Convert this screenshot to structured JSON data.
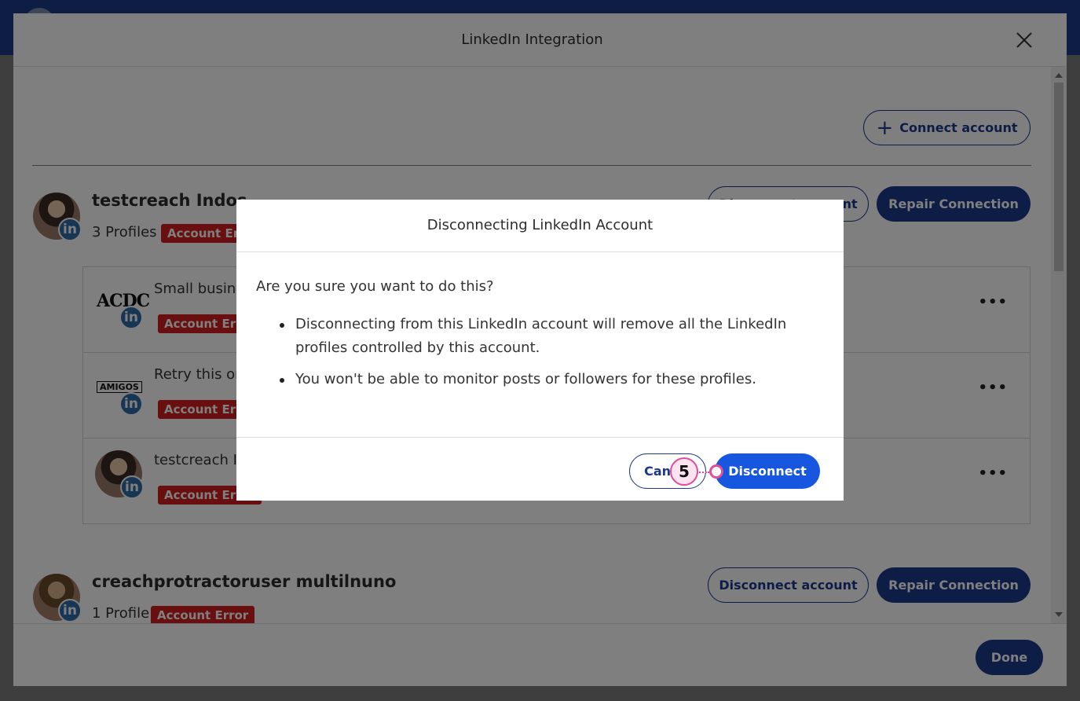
{
  "modal": {
    "title": "LinkedIn Integration",
    "connect_label": "Connect account",
    "done_label": "Done"
  },
  "accounts": [
    {
      "name": "testcreach Indos",
      "profiles_count": "3 Profiles",
      "error_badge": "Account Error",
      "disconnect_label": "Disconnect account",
      "repair_label": "Repair Connection",
      "profiles": [
        {
          "title": "Small business ...",
          "error_badge": "Account Error",
          "logo": "ACDC"
        },
        {
          "title": "Retry this one ...",
          "error_badge": "Account Error",
          "logo": "AMIGOS"
        },
        {
          "title": "testcreach Indos",
          "error_badge": "Account Error"
        }
      ]
    },
    {
      "name": "creachprotractoruser multilnuno",
      "profiles_count": "1 Profile",
      "error_badge": "Account Error",
      "disconnect_label": "Disconnect account",
      "repair_label": "Repair Connection"
    }
  ],
  "linkedin_badge": "in",
  "more_label": "•••",
  "dialog": {
    "title": "Disconnecting LinkedIn Account",
    "question": "Are you sure you want to do this?",
    "bullets": [
      "Disconnecting from this LinkedIn account will remove all the LinkedIn profiles controlled by this account.",
      "You won't be able to monitor posts or followers for these profiles."
    ],
    "cancel_label": "Cancel",
    "disconnect_label": "Disconnect"
  },
  "annotation": {
    "step": "5"
  },
  "colors": {
    "primary": "#1b3a8c",
    "error": "#d41f1f",
    "linkedin": "#2f6ca6",
    "dialog_primary": "#1757e0",
    "annotation": "#e64b97"
  }
}
